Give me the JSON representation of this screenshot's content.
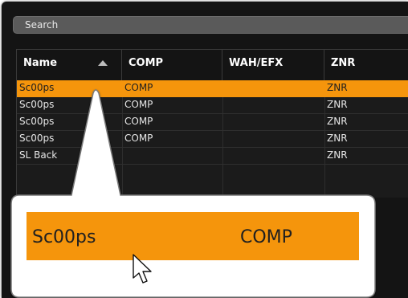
{
  "search": {
    "placeholder": "Search"
  },
  "table": {
    "columns": [
      "Name",
      "COMP",
      "WAH/EFX",
      "ZNR"
    ],
    "sort": {
      "column": "Name",
      "direction": "ascending"
    },
    "rows": [
      {
        "name": "Sc00ps",
        "comp": "COMP",
        "wah": "",
        "znr": "ZNR",
        "selected": true
      },
      {
        "name": "Sc00ps",
        "comp": "COMP",
        "wah": "",
        "znr": "ZNR",
        "selected": false
      },
      {
        "name": "Sc00ps",
        "comp": "COMP",
        "wah": "",
        "znr": "ZNR",
        "selected": false
      },
      {
        "name": "Sc00ps",
        "comp": "COMP",
        "wah": "",
        "znr": "ZNR",
        "selected": false
      },
      {
        "name": "SL Back",
        "comp": "",
        "wah": "",
        "znr": "ZNR",
        "selected": false
      }
    ]
  },
  "callout": {
    "name": "Sc00ps",
    "comp": "COMP",
    "accent": "#f5950c"
  },
  "icons": {
    "cursor": "cursor-arrow-icon",
    "sort": "sort-ascending-icon"
  }
}
